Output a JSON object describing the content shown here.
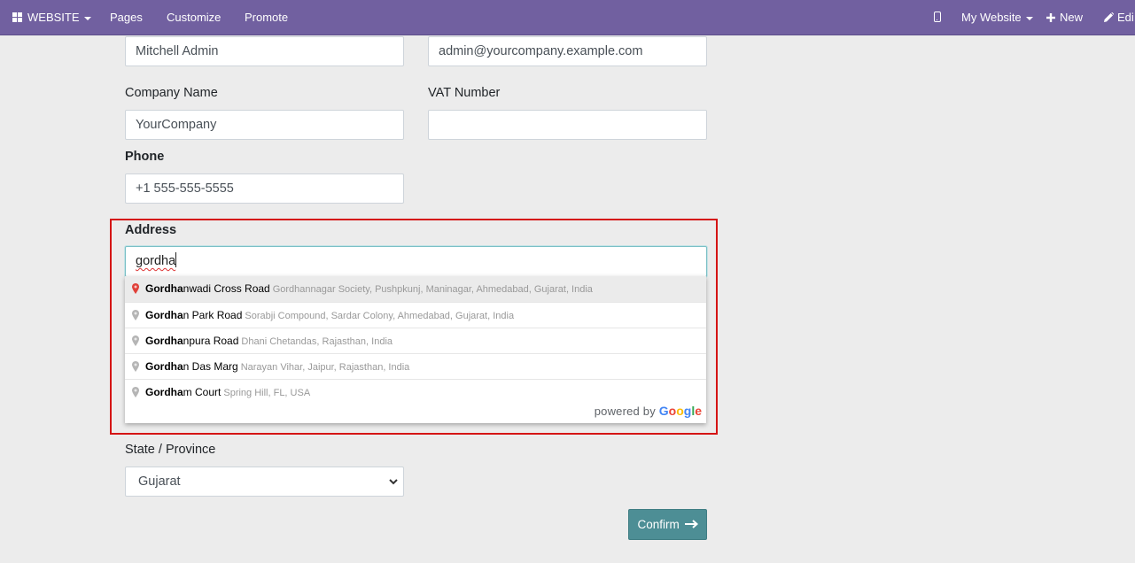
{
  "navbar": {
    "website_label": "WEBSITE",
    "pages_label": "Pages",
    "customize_label": "Customize",
    "promote_label": "Promote",
    "my_website_label": "My Website",
    "new_label": "New",
    "edit_label": "Edi"
  },
  "form": {
    "name_value": "Mitchell Admin",
    "email_value": "admin@yourcompany.example.com",
    "company_label": "Company Name",
    "company_value": "YourCompany",
    "vat_label": "VAT Number",
    "vat_value": "",
    "phone_label": "Phone",
    "phone_value": "+1 555-555-5555",
    "address_label": "Address",
    "address_value": "gordha",
    "state_label": "State / Province",
    "state_value": "Gujarat",
    "confirm_label": "Confirm"
  },
  "autocomplete": {
    "suggestions": [
      {
        "match": "Gordha",
        "rest": "nwadi Cross Road",
        "secondary": "Gordhannagar Society, Pushpkunj, Maninagar, Ahmedabad, Gujarat, India"
      },
      {
        "match": "Gordha",
        "rest": "n Park Road",
        "secondary": "Sorabji Compound, Sardar Colony, Ahmedabad, Gujarat, India"
      },
      {
        "match": "Gordha",
        "rest": "npura Road",
        "secondary": "Dhani Chetandas, Rajasthan, India"
      },
      {
        "match": "Gordha",
        "rest": "n Das Marg",
        "secondary": "Narayan Vihar, Jaipur, Rajasthan, India"
      },
      {
        "match": "Gordha",
        "rest": "m Court",
        "secondary": "Spring Hill, FL, USA"
      }
    ],
    "powered_by": "powered by",
    "google_letters": [
      "G",
      "o",
      "o",
      "g",
      "l",
      "e"
    ]
  },
  "colors": {
    "navbar_bg": "#7160a0",
    "highlight_border": "#d51515",
    "confirm_bg": "#4d8e95",
    "pin_active": "#e0413a",
    "pin_inactive": "#b5b5b5",
    "google_blue": "#4285f4",
    "google_red": "#ea4335",
    "google_yellow": "#fbbc05",
    "google_green": "#34a853"
  },
  "icons": {
    "apps": "grid-icon",
    "device": "mobile-icon",
    "new": "plus-icon",
    "edit": "pencil-icon",
    "suggestion": "map-pin-icon",
    "select": "chevron-down-icon",
    "confirm": "arrow-right-icon"
  }
}
